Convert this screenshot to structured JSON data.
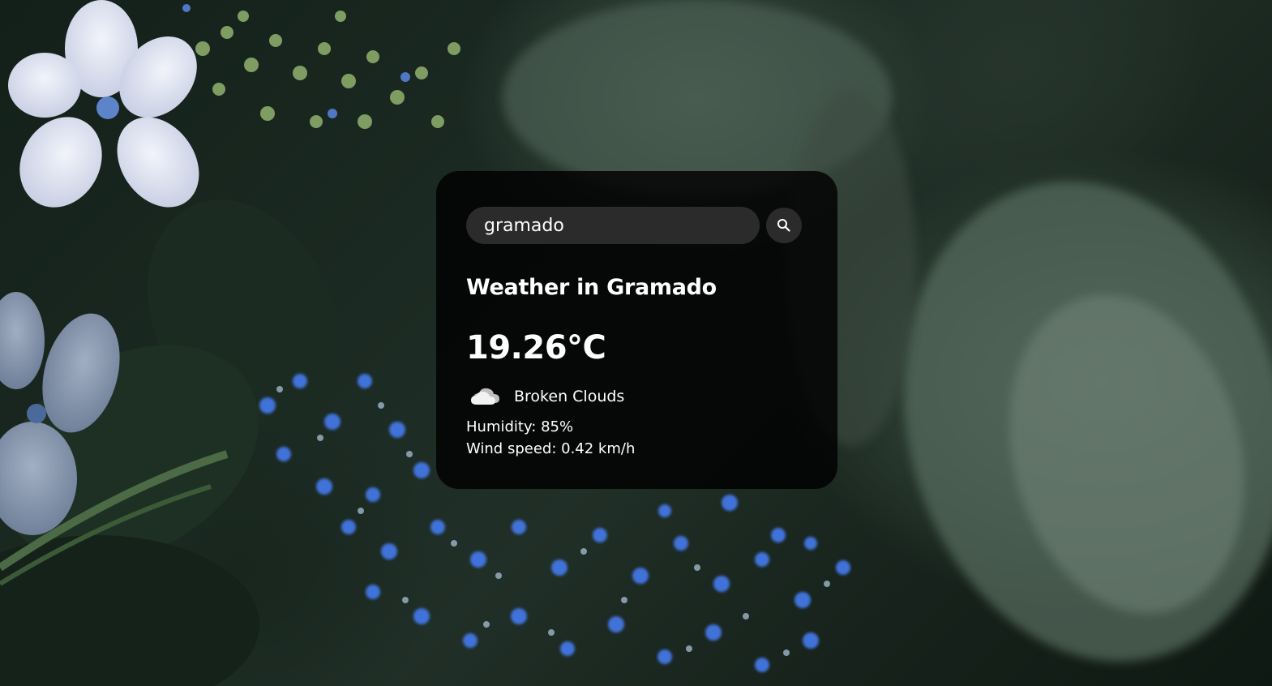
{
  "search": {
    "value": "gramado",
    "icon": "search-icon"
  },
  "weather": {
    "title": "Weather in Gramado",
    "temperature": "19.26°C",
    "condition": "Broken Clouds",
    "condition_icon": "broken-clouds-icon",
    "humidity": "Humidity: 85%",
    "wind": "Wind speed: 0.42 km/h"
  },
  "colors": {
    "card_background": "#000000",
    "input_background": "#2b2b2b",
    "text": "#ffffff"
  }
}
